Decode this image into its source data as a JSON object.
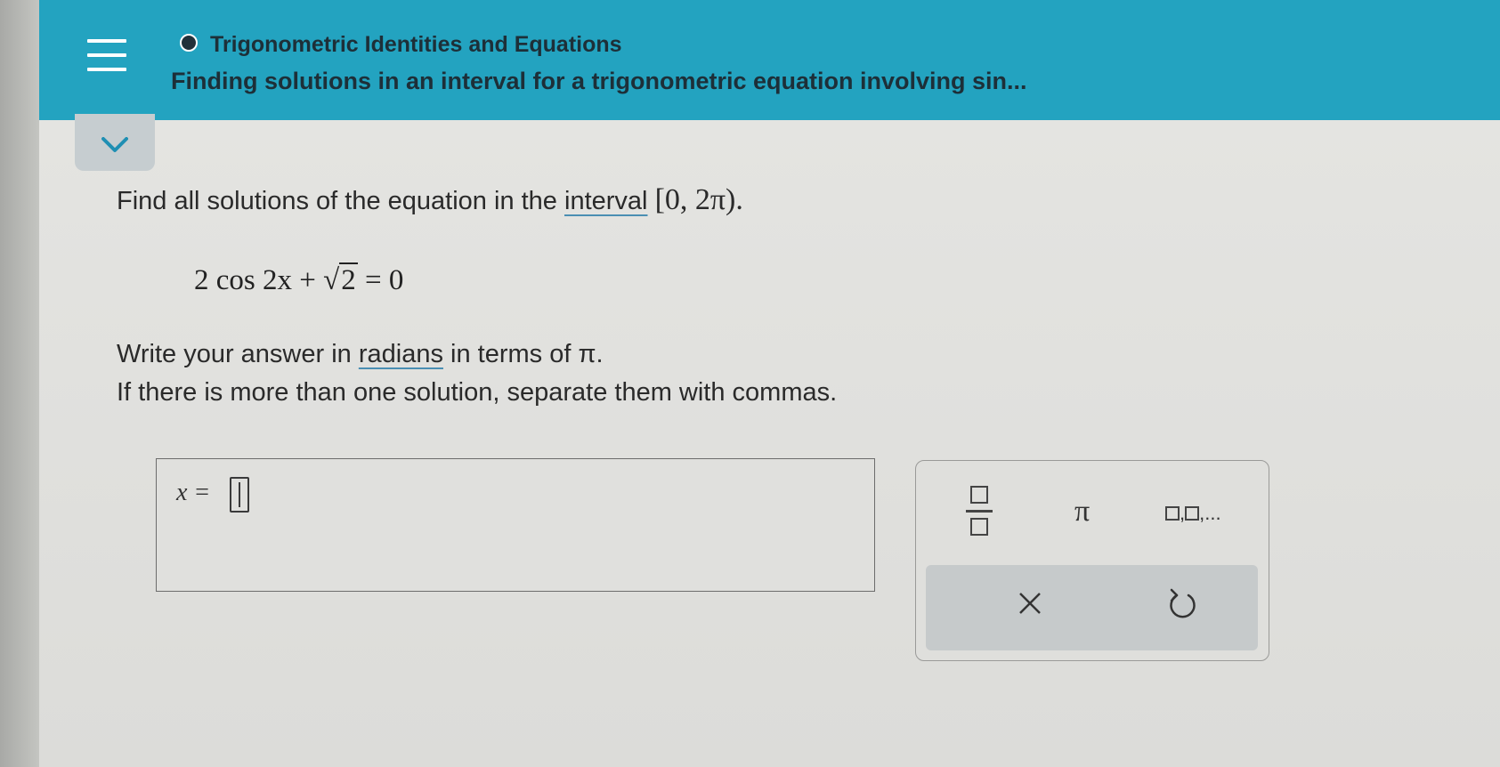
{
  "header": {
    "topic": "Trigonometric Identities and Equations",
    "problem_title": "Finding solutions in an interval for a trigonometric equation involving sin..."
  },
  "question": {
    "prompt_start": "Find all solutions of the equation in the ",
    "prompt_link": "interval",
    "prompt_interval": "[0, 2π).",
    "equation_left": "2 cos 2x + ",
    "equation_sqrt": "2",
    "equation_right": " = 0",
    "instruction_start": "Write your answer in ",
    "instruction_link": "radians",
    "instruction_end": " in terms of π.",
    "instruction_2": "If there is more than one solution, separate them with commas."
  },
  "answer": {
    "label": "x =",
    "value": ""
  },
  "keypad": {
    "pi_label": "π",
    "list_suffix": ",..."
  },
  "colors": {
    "header_bg": "#23a3c0",
    "text": "#2a2a2a"
  }
}
